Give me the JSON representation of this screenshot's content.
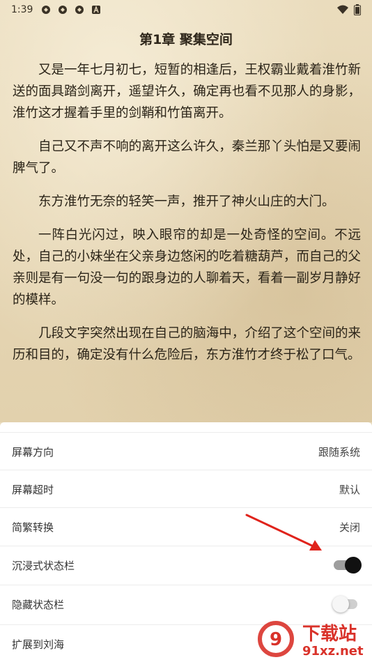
{
  "status_bar": {
    "time": "1:39",
    "left_icons": [
      "sync-icon",
      "sync-icon",
      "sync-icon",
      "a-badge-icon"
    ],
    "right_icons": [
      "wifi-icon",
      "battery-icon"
    ]
  },
  "reader": {
    "chapter_title": "第1章 聚集空间",
    "paragraphs": [
      "又是一年七月初七，短暂的相逢后，王权霸业戴着淮竹新送的面具踏剑离开，遥望许久，确定再也看不见那人的身影，淮竹这才握着手里的剑鞘和竹笛离开。",
      "自己又不声不响的离开这么许久，秦兰那丫头怕是又要闹脾气了。",
      "东方淮竹无奈的轻笑一声，推开了神火山庄的大门。",
      "一阵白光闪过，映入眼帘的却是一处奇怪的空间。不远处，自己的小妹坐在父亲身边悠闲的吃着糖葫芦，而自己的父亲则是有一句没一句的跟身边的人聊着天，看着一副岁月静好的模样。",
      "几段文字突然出现在自己的脑海中，介绍了这个空间的来历和目的，确定没有什么危险后，东方淮竹才终于松了口气。"
    ]
  },
  "settings": [
    {
      "label": "屏幕方向",
      "value": "跟随系统"
    },
    {
      "label": "屏幕超时",
      "value": "默认"
    },
    {
      "label": "简繁转换",
      "value": "关闭"
    },
    {
      "label": "沉浸式状态栏",
      "toggle": true
    },
    {
      "label": "隐藏状态栏",
      "toggle": false
    },
    {
      "label": "扩展到刘海"
    }
  ],
  "annotation": {
    "arrow_color": "#e0231b"
  },
  "watermark": {
    "brand_text": "下载站",
    "url_text": "91xz.net",
    "color": "#d9322a"
  }
}
